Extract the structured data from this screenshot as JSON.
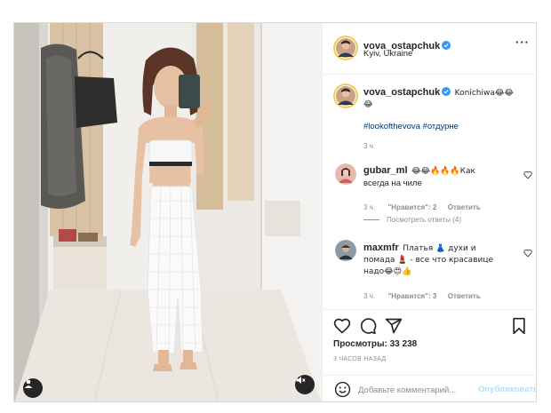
{
  "post": {
    "author": "vova_ostapchuk",
    "location": "Kyiv, Ukraine",
    "more_label": "···"
  },
  "caption": {
    "author": "vova_ostapchuk",
    "text": "Konichiwa😂😂",
    "text_line2": "😂",
    "hashtags": "#lookofthevova #отдурне",
    "time": "3 ч."
  },
  "comments": [
    {
      "author": "gubar_ml",
      "text": "😂😂🔥🔥🔥Как",
      "text_line2": "всегда на чиле",
      "time": "3 ч.",
      "likes": "\"Нравится\": 2",
      "reply": "Ответить",
      "view_replies": "Посмотреть ответы (4)"
    },
    {
      "author": "maxmfr",
      "text": "Платья 👗 духи и",
      "text_line2": "помада 💄 - все что красавице",
      "text_line3": "надо😂😍👍",
      "time": "3 ч.",
      "likes": "\"Нравится\": 3",
      "reply": "Ответить"
    }
  ],
  "stats": {
    "views": "Просмотры: 33 238",
    "ago": "3 ЧАСОВ НАЗАД"
  },
  "add_comment": {
    "placeholder": "Добавьте комментарий...",
    "publish": "Опубликовать"
  },
  "icons": {
    "user_tag": "user-tag-icon",
    "mute": "mute-icon",
    "verified": "verified-badge-icon",
    "heart": "heart-icon",
    "comment": "comment-icon",
    "share": "share-icon",
    "save": "bookmark-icon",
    "emoji": "emoji-icon"
  },
  "colors": {
    "verified": "#3897f0",
    "hashtag": "#00376b",
    "publish_disabled": "#b2dffc",
    "muted_text": "#8e8e8e"
  }
}
